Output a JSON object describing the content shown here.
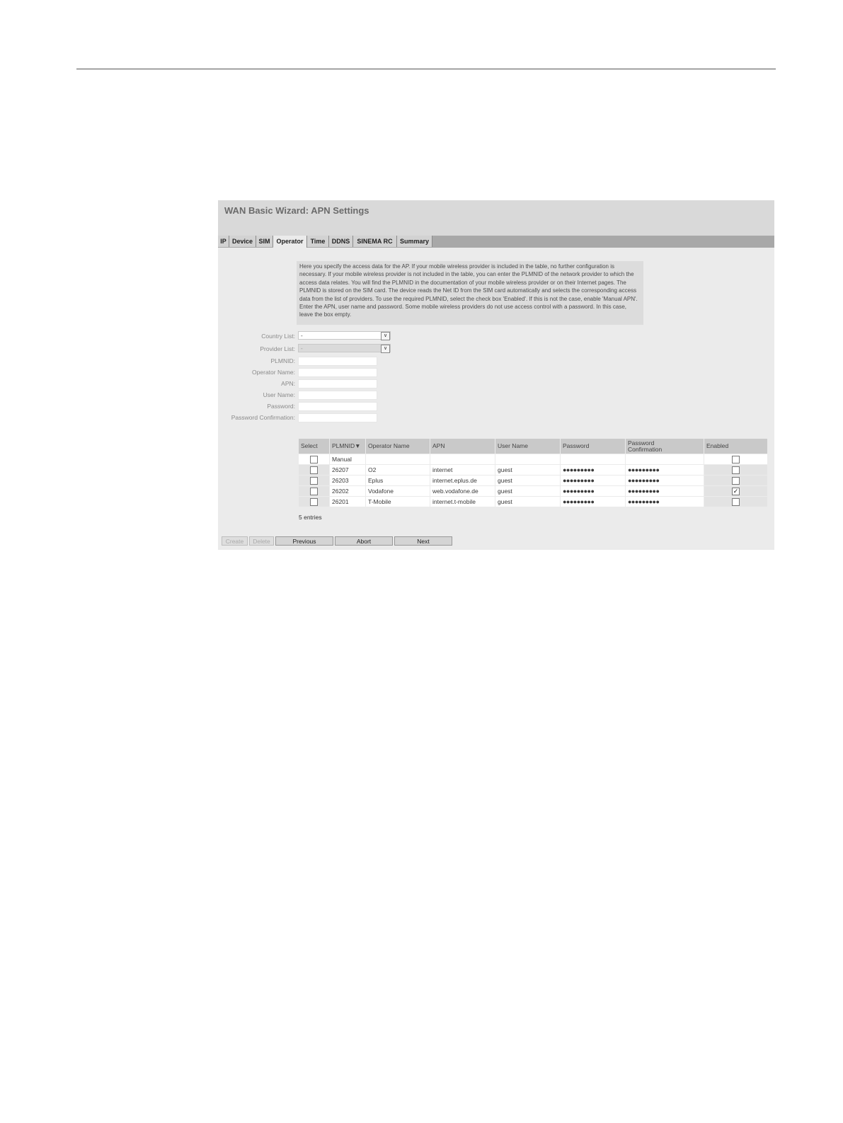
{
  "window": {
    "title": "WAN Basic Wizard: APN Settings"
  },
  "tabs": [
    {
      "label": "IP"
    },
    {
      "label": "Device"
    },
    {
      "label": "SIM"
    },
    {
      "label": "Operator"
    },
    {
      "label": "Time"
    },
    {
      "label": "DDNS"
    },
    {
      "label": "SINEMA RC"
    },
    {
      "label": "Summary"
    }
  ],
  "active_tab": "Operator",
  "info_text": "Here you specify the access data for the AP. If your mobile wireless provider is included in the table, no further configuration is necessary. If your mobile wireless provider is not included in the table, you can enter the PLMNID of the network provider to which the access data relates. You will find the PLMNID in the documentation of your mobile wireless provider or on their Internet pages. The PLMNID is stored on the SIM card. The device reads the Net ID from the SIM card automatically and selects the corresponding access data from the list of providers. To use the required PLMNID, select the check box 'Enabled'. If this is not the case, enable 'Manual APN'. Enter the APN, user name and password. Some mobile wireless providers do not use access control with a password. In this case, leave the box empty.",
  "form": {
    "country_list": {
      "label": "Country List:",
      "value": "-"
    },
    "provider_list": {
      "label": "Provider List:",
      "value": "-"
    },
    "plmnid": {
      "label": "PLMNID:"
    },
    "operator_name": {
      "label": "Operator Name:"
    },
    "apn": {
      "label": "APN:"
    },
    "user_name": {
      "label": "User Name:"
    },
    "password": {
      "label": "Password:"
    },
    "password_confirmation": {
      "label": "Password Confirmation:"
    }
  },
  "table": {
    "headers": {
      "select": "Select",
      "plmnid": "PLMNID▼",
      "operator_name": "Operator Name",
      "apn": "APN",
      "user_name": "User Name",
      "password": "Password",
      "password_confirmation_1": "Password",
      "password_confirmation_2": "Confirmation",
      "enabled": "Enabled"
    },
    "rows": [
      {
        "select": false,
        "plmnid": "Manual",
        "operator": "",
        "apn": "",
        "user": "",
        "password": "",
        "confirm": "",
        "enabled": false
      },
      {
        "select": false,
        "plmnid": "26207",
        "operator": "O2",
        "apn": "internet",
        "user": "guest",
        "password": "●●●●●●●●●",
        "confirm": "●●●●●●●●●",
        "enabled": false
      },
      {
        "select": false,
        "plmnid": "26203",
        "operator": "Eplus",
        "apn": "internet.eplus.de",
        "user": "guest",
        "password": "●●●●●●●●●",
        "confirm": "●●●●●●●●●",
        "enabled": false
      },
      {
        "select": false,
        "plmnid": "26202",
        "operator": "Vodafone",
        "apn": "web.vodafone.de",
        "user": "guest",
        "password": "●●●●●●●●●",
        "confirm": "●●●●●●●●●",
        "enabled": true
      },
      {
        "select": false,
        "plmnid": "26201",
        "operator": "T-Mobile",
        "apn": "internet.t-mobile",
        "user": "guest",
        "password": "●●●●●●●●●",
        "confirm": "●●●●●●●●●",
        "enabled": false
      }
    ],
    "entries": "5 entries"
  },
  "buttons": {
    "create": "Create",
    "delete": "Delete",
    "previous": "Previous",
    "abort": "Abort",
    "next": "Next"
  },
  "icons": {
    "dropdown": "chevron-down-icon",
    "check": "checkmark-icon"
  },
  "colors": {
    "title_bar": "#d9d9d9",
    "tab_bar": "#a8a8a8",
    "panel": "#ebebeb"
  }
}
